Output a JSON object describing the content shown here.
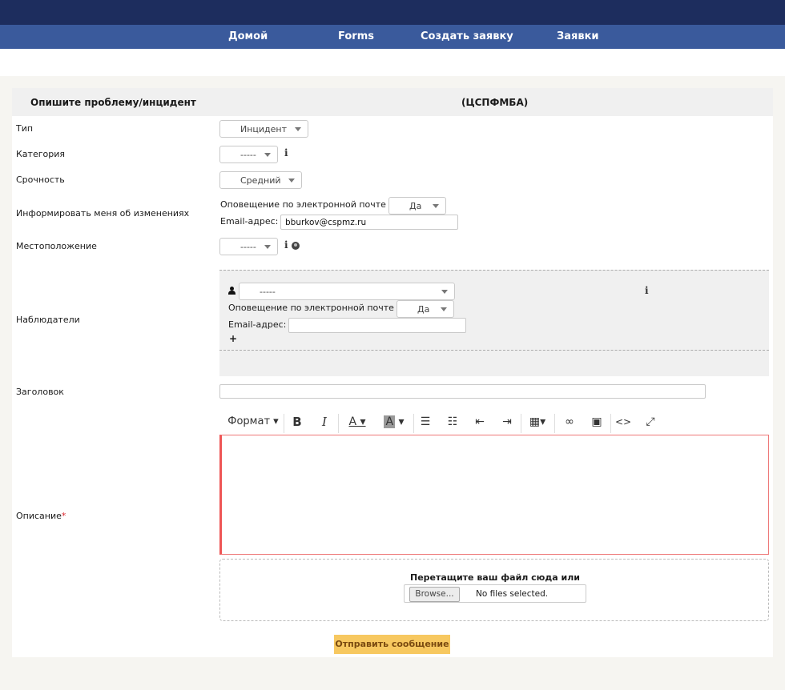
{
  "nav": {
    "home": "Домой",
    "forms": "Forms",
    "create_ticket": "Создать заявку",
    "tickets": "Заявки"
  },
  "form": {
    "header_title": "Опишите проблему/инцидент",
    "header_entity": "(ЦСПФМБА)",
    "type": {
      "label": "Тип",
      "value": "Инцидент"
    },
    "category": {
      "label": "Категория",
      "value": "-----"
    },
    "urgency": {
      "label": "Срочность",
      "value": "Средний"
    },
    "notify": {
      "label": "Информировать меня об изменениях",
      "email_notify_label": "Оповещение по электронной почте",
      "email_notify_value": "Да",
      "email_label": "Email-адрес:",
      "email_value": "bburkov@cspmz.ru"
    },
    "location": {
      "label": "Местоположение",
      "value": "-----"
    },
    "observers": {
      "label": "Наблюдатели",
      "value": "-----",
      "email_notify_label": "Оповещение по электронной почте",
      "email_notify_value": "Да",
      "email_label": "Email-адрес:",
      "email_value": ""
    },
    "title": {
      "label": "Заголовок",
      "value": ""
    },
    "description": {
      "label": "Описание",
      "required_mark": "*"
    },
    "toolbar": {
      "format_label": "Формат"
    },
    "upload": {
      "drop_text": "Перетащите ваш файл сюда или",
      "browse_label": "Browse...",
      "status": "No files selected."
    },
    "submit_label": "Отправить сообщение"
  },
  "colors": {
    "topbar": "#1d2d5e",
    "navbar": "#3a5a9c",
    "submit": "#f7c860",
    "editor_border": "#e55"
  }
}
